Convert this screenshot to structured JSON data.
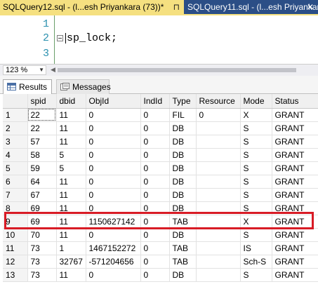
{
  "tabs": [
    {
      "label": "SQLQuery12.sql - (l...esh Priyankara (73))*",
      "close": "⊓",
      "active": true
    },
    {
      "label": "SQLQuery11.sql - (l...esh Priyankara",
      "close": "✕",
      "active": false
    }
  ],
  "editor": {
    "line_numbers": [
      "1",
      "2",
      "3"
    ],
    "code": "sp_lock;"
  },
  "zoom": {
    "value": "123 %"
  },
  "result_tabs": {
    "results": "Results",
    "messages": "Messages"
  },
  "grid": {
    "columns": [
      "spid",
      "dbid",
      "ObjId",
      "IndId",
      "Type",
      "Resource",
      "Mode",
      "Status"
    ],
    "rows": [
      {
        "n": "1",
        "cells": [
          "22",
          "11",
          "0",
          "0",
          "FIL",
          "0",
          "X",
          "GRANT"
        ]
      },
      {
        "n": "2",
        "cells": [
          "22",
          "11",
          "0",
          "0",
          "DB",
          "",
          "S",
          "GRANT"
        ]
      },
      {
        "n": "3",
        "cells": [
          "57",
          "11",
          "0",
          "0",
          "DB",
          "",
          "S",
          "GRANT"
        ]
      },
      {
        "n": "4",
        "cells": [
          "58",
          "5",
          "0",
          "0",
          "DB",
          "",
          "S",
          "GRANT"
        ]
      },
      {
        "n": "5",
        "cells": [
          "59",
          "5",
          "0",
          "0",
          "DB",
          "",
          "S",
          "GRANT"
        ]
      },
      {
        "n": "6",
        "cells": [
          "64",
          "11",
          "0",
          "0",
          "DB",
          "",
          "S",
          "GRANT"
        ]
      },
      {
        "n": "7",
        "cells": [
          "67",
          "11",
          "0",
          "0",
          "DB",
          "",
          "S",
          "GRANT"
        ]
      },
      {
        "n": "8",
        "cells": [
          "69",
          "11",
          "0",
          "0",
          "DB",
          "",
          "S",
          "GRANT"
        ]
      },
      {
        "n": "9",
        "cells": [
          "69",
          "11",
          "1150627142",
          "0",
          "TAB",
          "",
          "X",
          "GRANT"
        ]
      },
      {
        "n": "10",
        "cells": [
          "70",
          "11",
          "0",
          "0",
          "DB",
          "",
          "S",
          "GRANT"
        ]
      },
      {
        "n": "11",
        "cells": [
          "73",
          "1",
          "1467152272",
          "0",
          "TAB",
          "",
          "IS",
          "GRANT"
        ]
      },
      {
        "n": "12",
        "cells": [
          "73",
          "32767",
          "-571204656",
          "0",
          "TAB",
          "",
          "Sch-S",
          "GRANT"
        ]
      },
      {
        "n": "13",
        "cells": [
          "73",
          "11",
          "0",
          "0",
          "DB",
          "",
          "S",
          "GRANT"
        ]
      }
    ]
  },
  "colors": {
    "accent_tab": "#f5e080",
    "tabstrip": "#2b4e86",
    "highlight": "#d81b25"
  }
}
